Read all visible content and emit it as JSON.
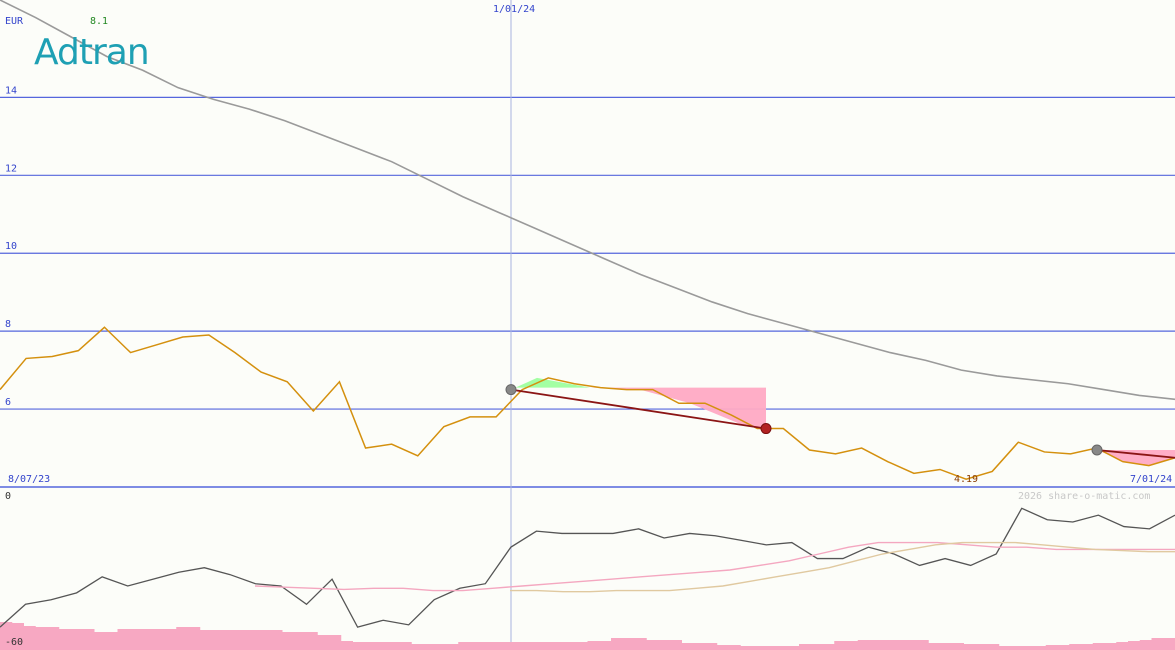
{
  "chart_data": [
    {
      "type": "line",
      "currency": "EUR",
      "last_value": "8.1",
      "logo_text": "Adtran",
      "yticks": [
        "14",
        "12",
        "10",
        "8",
        "6"
      ],
      "ytick_values": [
        14,
        12,
        10,
        8,
        6
      ],
      "ylim": [
        4,
        16.5
      ],
      "date_labels": [
        "8/07/23",
        "1/01/24",
        "7/01/24"
      ],
      "min_label": "4.19",
      "watermark": "2026 share-o-matic.com",
      "colors": {
        "price": "#d4900e",
        "average": "#9a9a9a",
        "grid": "#5566dd",
        "trend": "#8b1515",
        "fill_up": "#99ff99",
        "fill_down": "#ffaac4"
      },
      "series": [
        {
          "key": "price",
          "values": [
            6.5,
            7.3,
            7.35,
            7.5,
            8.1,
            7.45,
            7.65,
            7.85,
            7.9,
            7.45,
            6.95,
            6.7,
            5.95,
            6.7,
            5.0,
            5.1,
            4.8,
            5.55,
            5.8,
            5.8,
            6.5,
            6.8,
            6.65,
            6.55,
            6.5,
            6.5,
            6.15,
            6.15,
            5.85,
            5.5,
            5.5,
            4.95,
            4.85,
            5.0,
            4.65,
            4.35,
            4.45,
            4.2,
            4.4,
            5.15,
            4.9,
            4.85,
            5.0,
            4.65,
            4.55,
            4.75
          ]
        },
        {
          "key": "average",
          "values": [
            16.5,
            16.05,
            15.55,
            15.05,
            14.7,
            14.25,
            13.95,
            13.7,
            13.4,
            13.05,
            12.7,
            12.35,
            11.9,
            11.45,
            11.05,
            10.65,
            10.25,
            9.85,
            9.45,
            9.1,
            8.75,
            8.45,
            8.2,
            7.95,
            7.7,
            7.45,
            7.25,
            7.0,
            6.85,
            6.75,
            6.65,
            6.5,
            6.35,
            6.25
          ]
        }
      ],
      "trend_lines": [
        {
          "start": 6.5,
          "end": 5.5
        },
        {
          "start": 4.95,
          "end": 4.75
        }
      ]
    },
    {
      "type": "line",
      "yticks": [
        "0",
        "-60"
      ],
      "series": [
        {
          "key": "oscillator",
          "values": [
            -60,
            -50,
            -48,
            -45,
            -38,
            -42,
            -39,
            -36,
            -34,
            -37,
            -41,
            -42,
            -50,
            -39,
            -60,
            -57,
            -59,
            -48,
            -43,
            -41,
            -25,
            -18,
            -19,
            -19,
            -19,
            -17,
            -21,
            -19,
            -20,
            -22,
            -24,
            -23,
            -30,
            -30,
            -25,
            -28,
            -33,
            -30,
            -33,
            -28,
            -8,
            -13,
            -14,
            -11,
            -16,
            -17,
            -11
          ]
        },
        {
          "key": "signal_fast",
          "values": [
            -42,
            -42.5,
            -43,
            -43.5,
            -43,
            -43,
            -44,
            -44,
            -43,
            -42,
            -41,
            -40,
            -39,
            -38,
            -37,
            -36,
            -35,
            -33,
            -31,
            -28,
            -25,
            -23,
            -23,
            -23,
            -24,
            -25,
            -25,
            -26,
            -26,
            -26,
            -26,
            -26
          ]
        },
        {
          "key": "signal_slow",
          "values": [
            -44,
            -44,
            -44.5,
            -44.5,
            -44,
            -44,
            -44,
            -43,
            -42,
            -40,
            -38,
            -36,
            -34,
            -31,
            -28,
            -26,
            -24,
            -23,
            -23,
            -23,
            -24,
            -25,
            -26,
            -26.5,
            -27,
            -27
          ]
        }
      ],
      "histogram": [
        28,
        27,
        24,
        23,
        23,
        21,
        21,
        21,
        18,
        18,
        21,
        21,
        21,
        21,
        21,
        23,
        23,
        20,
        20,
        20,
        20,
        20,
        20,
        20,
        18,
        18,
        18,
        15,
        15,
        9,
        8,
        8,
        8,
        8,
        8,
        6,
        6,
        6,
        6,
        8,
        8,
        8,
        8,
        8,
        8,
        8,
        8,
        8,
        8,
        8,
        9,
        9,
        12,
        12,
        12,
        10,
        10,
        10,
        7,
        7,
        7,
        5,
        5,
        4,
        4,
        4,
        4,
        4,
        6,
        6,
        6,
        9,
        9,
        10,
        10,
        10,
        10,
        10,
        10,
        7,
        7,
        7,
        6,
        6,
        6,
        4,
        4,
        4,
        4,
        5,
        5,
        6,
        6,
        7,
        7,
        8,
        9,
        10,
        12,
        12
      ]
    }
  ]
}
